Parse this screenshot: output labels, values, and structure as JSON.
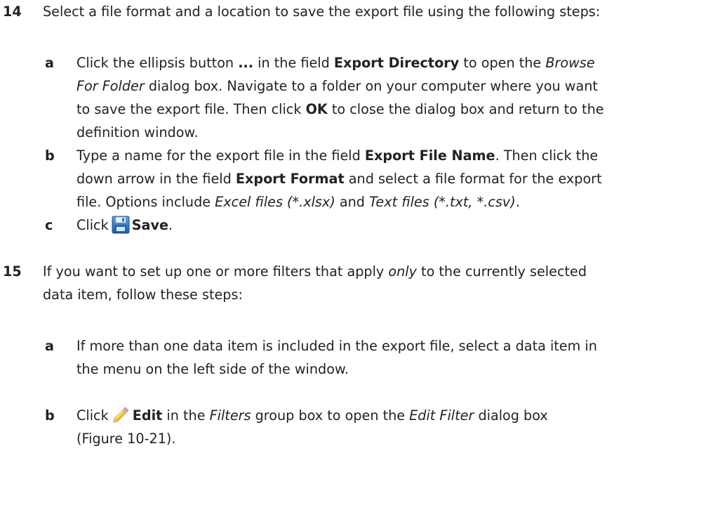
{
  "step14": {
    "number": "14",
    "text": "Select a file format and a location to save the export file using the following steps:",
    "a": {
      "letter": "a",
      "l1_pre": "Click the ellipsis button ",
      "l1_b1": "...",
      "l1_mid": " in the field ",
      "l1_b2": "Export Directory",
      "l1_mid2": " to open the ",
      "l1_i1": "Browse",
      "l2_i1": "For Folder",
      "l2_post": " dialog box. Navigate to a folder on your computer where you want",
      "l3_pre": "to save the export file. Then click ",
      "l3_b1": "OK",
      "l3_post": " to close the dialog box and return to the",
      "l4": "definition window."
    },
    "b": {
      "letter": "b",
      "l1_pre": "Type a name for the export file in the field ",
      "l1_b1": "Export File Name",
      "l1_post": ". Then click the",
      "l2_pre": "down arrow in the field ",
      "l2_b1": "Export Format",
      "l2_post": " and select a file format for the export",
      "l3_pre": "file. Options include ",
      "l3_i1": "Excel files (*.xlsx)",
      "l3_mid": " and ",
      "l3_i2": "Text files (*.txt, *.csv)",
      "l3_post": "."
    },
    "c": {
      "letter": "c",
      "pre": "Click",
      "icon": "save-icon",
      "b1": "Save",
      "post": "."
    }
  },
  "step15": {
    "number": "15",
    "l1_pre": "If you want to set up one or more filters that apply ",
    "l1_i1": "only",
    "l1_post": " to the currently selected",
    "l2": "data item, follow these steps:",
    "a": {
      "letter": "a",
      "l1": "If more than one data item is included in the export file, select a data item in",
      "l2": "the menu on the left side of the window."
    },
    "b": {
      "letter": "b",
      "l1_pre": "Click",
      "icon": "edit-icon",
      "l1_b1": "Edit",
      "l1_mid": " in the ",
      "l1_i1": "Filters",
      "l1_mid2": " group box to open the ",
      "l1_i2": "Edit Filter",
      "l1_post": " dialog box",
      "l2": "(Figure 10-21)."
    }
  }
}
